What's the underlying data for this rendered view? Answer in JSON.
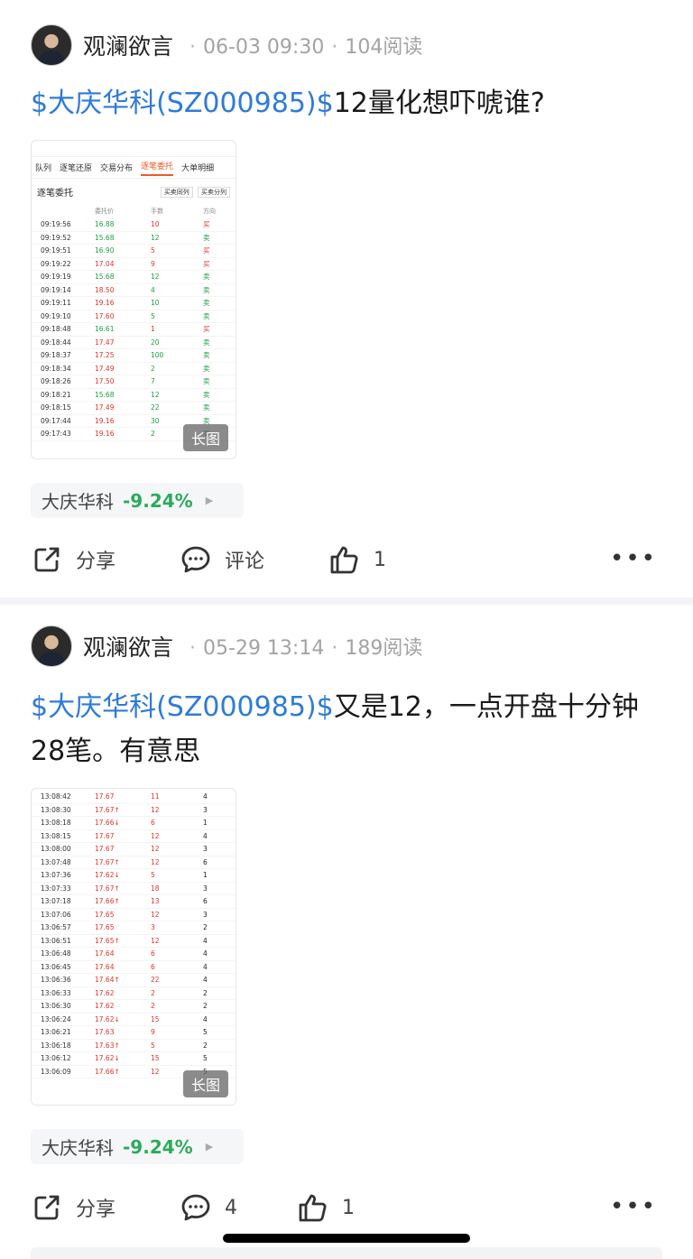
{
  "posts": [
    {
      "author": "观澜欲言",
      "date": "06-03 09:30",
      "reads": "104阅读",
      "stock_link": "$大庆华科(SZ000985)$",
      "text": "12量化想吓唬谁?",
      "image": {
        "badge": "长图",
        "tabs": [
          "队列",
          "逐笔还原",
          "交易分布",
          "逐笔委托",
          "大单明细"
        ],
        "title": "逐笔委托",
        "buttons": [
          "买卖同列",
          "买卖分列"
        ],
        "columns": [
          "",
          "委托价",
          "手数",
          "方向"
        ],
        "rows": [
          [
            "09:19:56",
            "16.88",
            "10",
            "买"
          ],
          [
            "09:19:52",
            "15.68",
            "12",
            "卖"
          ],
          [
            "09:19:51",
            "16.90",
            "5",
            "买"
          ],
          [
            "09:19:22",
            "17.04",
            "9",
            "买"
          ],
          [
            "09:19:19",
            "15.68",
            "12",
            "卖"
          ],
          [
            "09:19:14",
            "18.50",
            "4",
            "卖"
          ],
          [
            "09:19:11",
            "19.16",
            "10",
            "卖"
          ],
          [
            "09:19:10",
            "17.60",
            "5",
            "卖"
          ],
          [
            "09:18:48",
            "16.61",
            "1",
            "买"
          ],
          [
            "09:18:44",
            "17.47",
            "20",
            "卖"
          ],
          [
            "09:18:37",
            "17.25",
            "100",
            "卖"
          ],
          [
            "09:18:34",
            "17.49",
            "2",
            "卖"
          ],
          [
            "09:18:26",
            "17.50",
            "7",
            "卖"
          ],
          [
            "09:18:21",
            "15.68",
            "12",
            "卖"
          ],
          [
            "09:18:15",
            "17.49",
            "22",
            "卖"
          ],
          [
            "09:17:44",
            "19.16",
            "30",
            "卖"
          ],
          [
            "09:17:43",
            "19.16",
            "2",
            "卖"
          ]
        ]
      },
      "stock_tag": {
        "name": "大庆华科",
        "change": "-9.24%",
        "arrow": "▶"
      },
      "actions": {
        "share": "分享",
        "comment": "评论",
        "likes": "1",
        "more": "•••"
      }
    },
    {
      "author": "观澜欲言",
      "date": "05-29 13:14",
      "reads": "189阅读",
      "stock_link": "$大庆华科(SZ000985)$",
      "text": "又是12，一点开盘十分钟28笔。有意思",
      "image": {
        "badge": "长图",
        "rows": [
          [
            "13:08:42",
            "17.67",
            "11",
            "4"
          ],
          [
            "13:08:30",
            "17.67↑",
            "12",
            "3"
          ],
          [
            "13:08:18",
            "17.66↓",
            "6",
            "1"
          ],
          [
            "13:08:15",
            "17.67",
            "12",
            "4"
          ],
          [
            "13:08:00",
            "17.67",
            "12",
            "3"
          ],
          [
            "13:07:48",
            "17.67↑",
            "12",
            "6"
          ],
          [
            "13:07:36",
            "17.62↓",
            "5",
            "1"
          ],
          [
            "13:07:33",
            "17.67↑",
            "18",
            "3"
          ],
          [
            "13:07:18",
            "17.66↑",
            "13",
            "6"
          ],
          [
            "13:07:06",
            "17.65",
            "12",
            "3"
          ],
          [
            "13:06:57",
            "17.65",
            "3",
            "2"
          ],
          [
            "13:06:51",
            "17.65↑",
            "12",
            "4"
          ],
          [
            "13:06:48",
            "17.64",
            "6",
            "4"
          ],
          [
            "13:06:45",
            "17.64",
            "6",
            "4"
          ],
          [
            "13:06:36",
            "17.64↑",
            "22",
            "4"
          ],
          [
            "13:06:33",
            "17.62",
            "2",
            "2"
          ],
          [
            "13:06:30",
            "17.62",
            "2",
            "2"
          ],
          [
            "13:06:24",
            "17.62↓",
            "15",
            "4"
          ],
          [
            "13:06:21",
            "17.63",
            "9",
            "5"
          ],
          [
            "13:06:18",
            "17.63↑",
            "5",
            "2"
          ],
          [
            "13:06:12",
            "17.62↓",
            "15",
            "5"
          ],
          [
            "13:06:09",
            "17.66↑",
            "12",
            "5"
          ]
        ]
      },
      "stock_tag": {
        "name": "大庆华科",
        "change": "-9.24%",
        "arrow": "▶"
      },
      "actions": {
        "share": "分享",
        "comments": "4",
        "likes": "1",
        "more": "•••"
      }
    }
  ],
  "colors": {
    "link": "#2e7bd8",
    "down": "#2bab5b",
    "up_red": "#e0322a",
    "sell_green": "#1a9e3f"
  }
}
